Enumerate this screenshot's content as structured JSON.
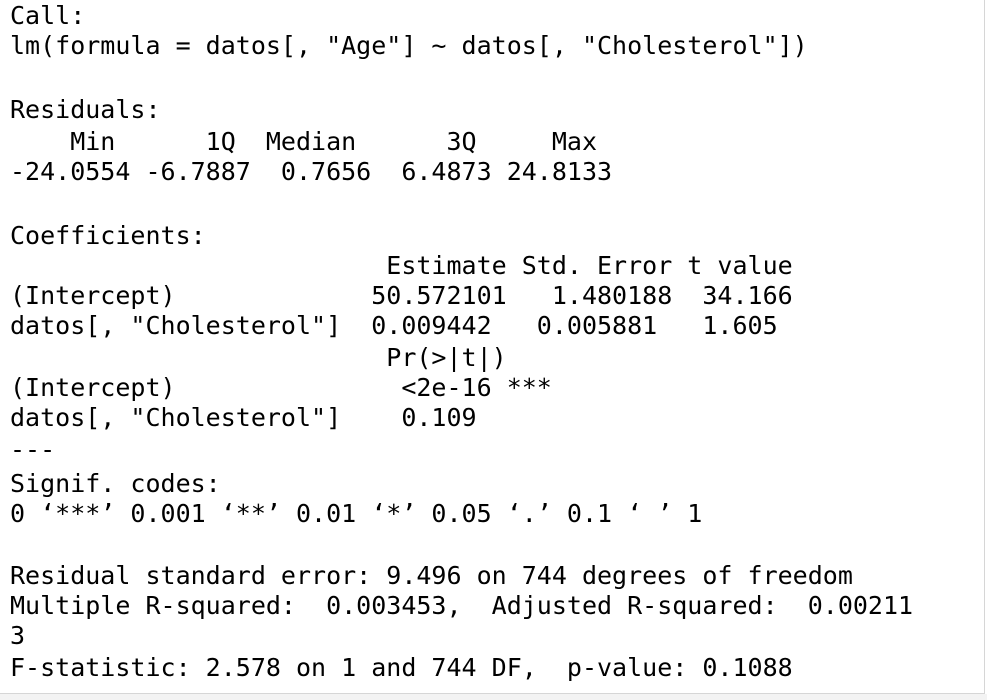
{
  "console": {
    "lines": {
      "l0": "Call:",
      "l1": "lm(formula = datos[, \"Age\"] ~ datos[, \"Cholesterol\"])",
      "l2": "",
      "l3": "Residuals:",
      "l4": "    Min      1Q  Median      3Q     Max ",
      "l5": "-24.0554 -6.7887  0.7656  6.4873 24.8133 ",
      "l6": "",
      "l7": "Coefficients:",
      "l8": "                         Estimate Std. Error t value",
      "l9": "(Intercept)             50.572101   1.480188  34.166",
      "l10": "datos[, \"Cholesterol\"]  0.009442   0.005881   1.605",
      "l11": "                         Pr(>|t|)    ",
      "l12": "(Intercept)               <2e-16 ***",
      "l13": "datos[, \"Cholesterol\"]    0.109    ",
      "l14": "---",
      "l15": "Signif. codes:  ",
      "l16": "0 ‘***’ 0.001 ‘**’ 0.01 ‘*’ 0.05 ‘.’ 0.1 ‘ ’ 1",
      "l17": "",
      "l18": "Residual standard error: 9.496 on 744 degrees of freedom",
      "l19": "Multiple R-squared:  0.003453,\tAdjusted R-squared:  0.00211",
      "l20": "3 ",
      "l21": "F-statistic: 2.578 on 1 and 744 DF,  p-value: 0.1088"
    }
  }
}
